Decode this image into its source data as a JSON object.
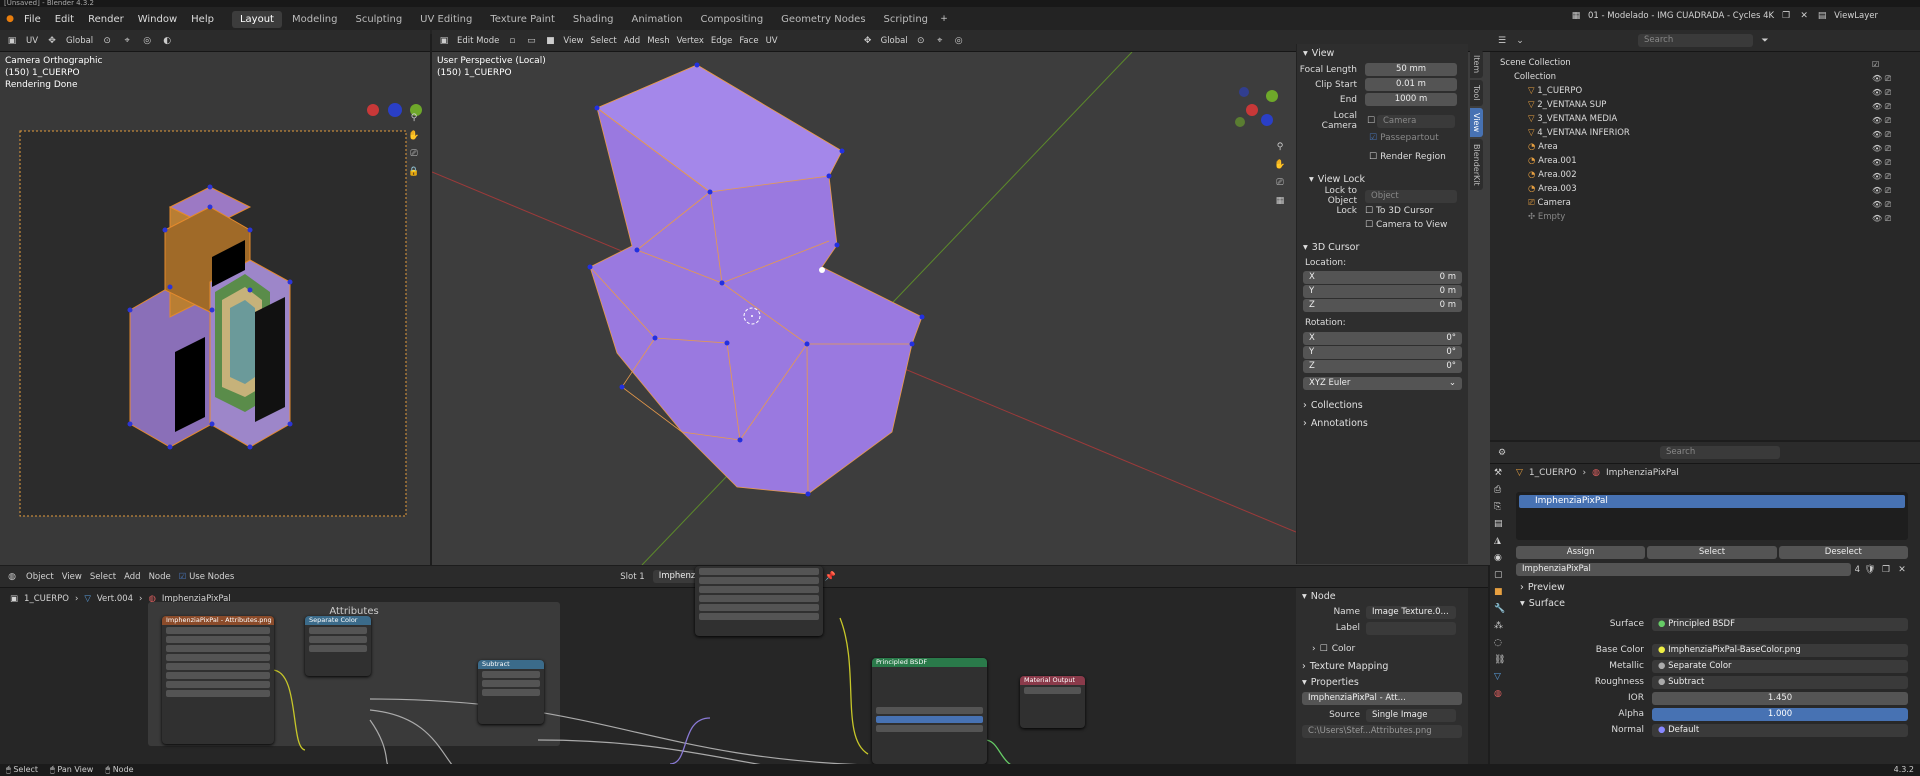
{
  "window_title": "[Unsaved] - Blender 4.3.2",
  "menu": [
    "File",
    "Edit",
    "Render",
    "Window",
    "Help"
  ],
  "workspaces": [
    "Layout",
    "Modeling",
    "Sculpting",
    "UV Editing",
    "Texture Paint",
    "Shading",
    "Animation",
    "Compositing",
    "Geometry Nodes",
    "Scripting"
  ],
  "active_workspace": "Layout",
  "scene_name": "01 - Modelado - IMG CUADRADA - Cycles 4K",
  "view_layer": "ViewLayer",
  "camera_view": {
    "editor": "UV",
    "transform": "Global",
    "line1": "Camera Orthographic",
    "line2": "(150) 1_CUERPO",
    "line3": "Rendering Done"
  },
  "viewport": {
    "mode": "Edit Mode",
    "menus": [
      "View",
      "Select",
      "Add",
      "Mesh",
      "Vertex",
      "Edge",
      "Face",
      "UV"
    ],
    "transform": "Global",
    "line1": "User Perspective (Local)",
    "line2": "(150) 1_CUERPO"
  },
  "npanel": {
    "view_header": "View",
    "focal_length_label": "Focal Length",
    "focal_length": "50 mm",
    "clip_start_label": "Clip Start",
    "clip_start": "0.01 m",
    "end_label": "End",
    "end": "1000 m",
    "local_camera_label": "Local Camera",
    "local_camera": "Camera",
    "passepartout": "Passepartout",
    "render_region": "Render Region",
    "view_lock_header": "View Lock",
    "lock_to_object_label": "Lock to Object",
    "lock_to_object": "Object",
    "lock_label": "Lock",
    "to_3d_cursor": "To 3D Cursor",
    "camera_to_view": "Camera to View",
    "cursor_header": "3D Cursor",
    "location_label": "Location:",
    "loc_x": "0 m",
    "loc_y": "0 m",
    "loc_z": "0 m",
    "rotation_label": "Rotation:",
    "rot_x": "0°",
    "rot_y": "0°",
    "rot_z": "0°",
    "rotation_mode": "XYZ Euler",
    "collections": "Collections",
    "annotations": "Annotations",
    "tabs": [
      "Item",
      "Tool",
      "View",
      "BlenderKit"
    ]
  },
  "outliner": {
    "search_placeholder": "Search",
    "items": [
      "Scene Collection",
      "Collection",
      "1_CUERPO",
      "2_VENTANA SUP",
      "3_VENTANA MEDIA",
      "4_VENTANA INFERIOR",
      "Area",
      "Area.001",
      "Area.002",
      "Area.003",
      "Camera",
      "Empty"
    ]
  },
  "properties": {
    "search_placeholder": "Search",
    "breadcrumb_object": "1_CUERPO",
    "breadcrumb_material": "ImphenziaPixPal",
    "slot": "ImphenziaPixPal",
    "assign": "Assign",
    "select": "Select",
    "deselect": "Deselect",
    "material_name": "ImphenziaPixPal",
    "users": "4",
    "preview": "Preview",
    "surface_header": "Surface",
    "surface_label": "Surface",
    "surface_value": "Principled BSDF",
    "base_color_label": "Base Color",
    "base_color_value": "ImphenziaPixPal-BaseColor.png",
    "metallic_label": "Metallic",
    "metallic_value": "Separate Color",
    "roughness_label": "Roughness",
    "roughness_value": "Subtract",
    "ior_label": "IOR",
    "ior_value": "1.450",
    "alpha_label": "Alpha",
    "alpha_value": "1.000",
    "normal_label": "Normal",
    "normal_value": "Default"
  },
  "node_editor": {
    "mode": "Object",
    "menus": [
      "View",
      "Select",
      "Add",
      "Node"
    ],
    "use_nodes": "Use Nodes",
    "slot": "Slot 1",
    "material": "ImphenziaPixPal",
    "users": "4",
    "breadcrumb_object": "1_CUERPO",
    "breadcrumb_vert": "Vert.004",
    "breadcrumb_material": "ImphenziaPixPal",
    "frame_title": "Attributes",
    "tex_node_title": "ImphenziaPixPal - Attributes.png",
    "separate_title": "Separate Color",
    "subtract_title": "Subtract",
    "bsdf_title": "Principled BSDF",
    "output_title": "Material Output",
    "side": {
      "node_header": "Node",
      "name_label": "Name",
      "name_value": "Image Texture.0...",
      "label_label": "Label",
      "color_label": "Color",
      "texture_mapping": "Texture Mapping",
      "properties": "Properties",
      "image_name": "ImphenziaPixPal - Att...",
      "source_label": "Source",
      "source_value": "Single Image",
      "filepath": "C:\\Users\\Stef...Attributes.png"
    }
  },
  "status": {
    "select": "Select",
    "pan": "Pan View",
    "node": "Node",
    "version": "4.3.2"
  }
}
